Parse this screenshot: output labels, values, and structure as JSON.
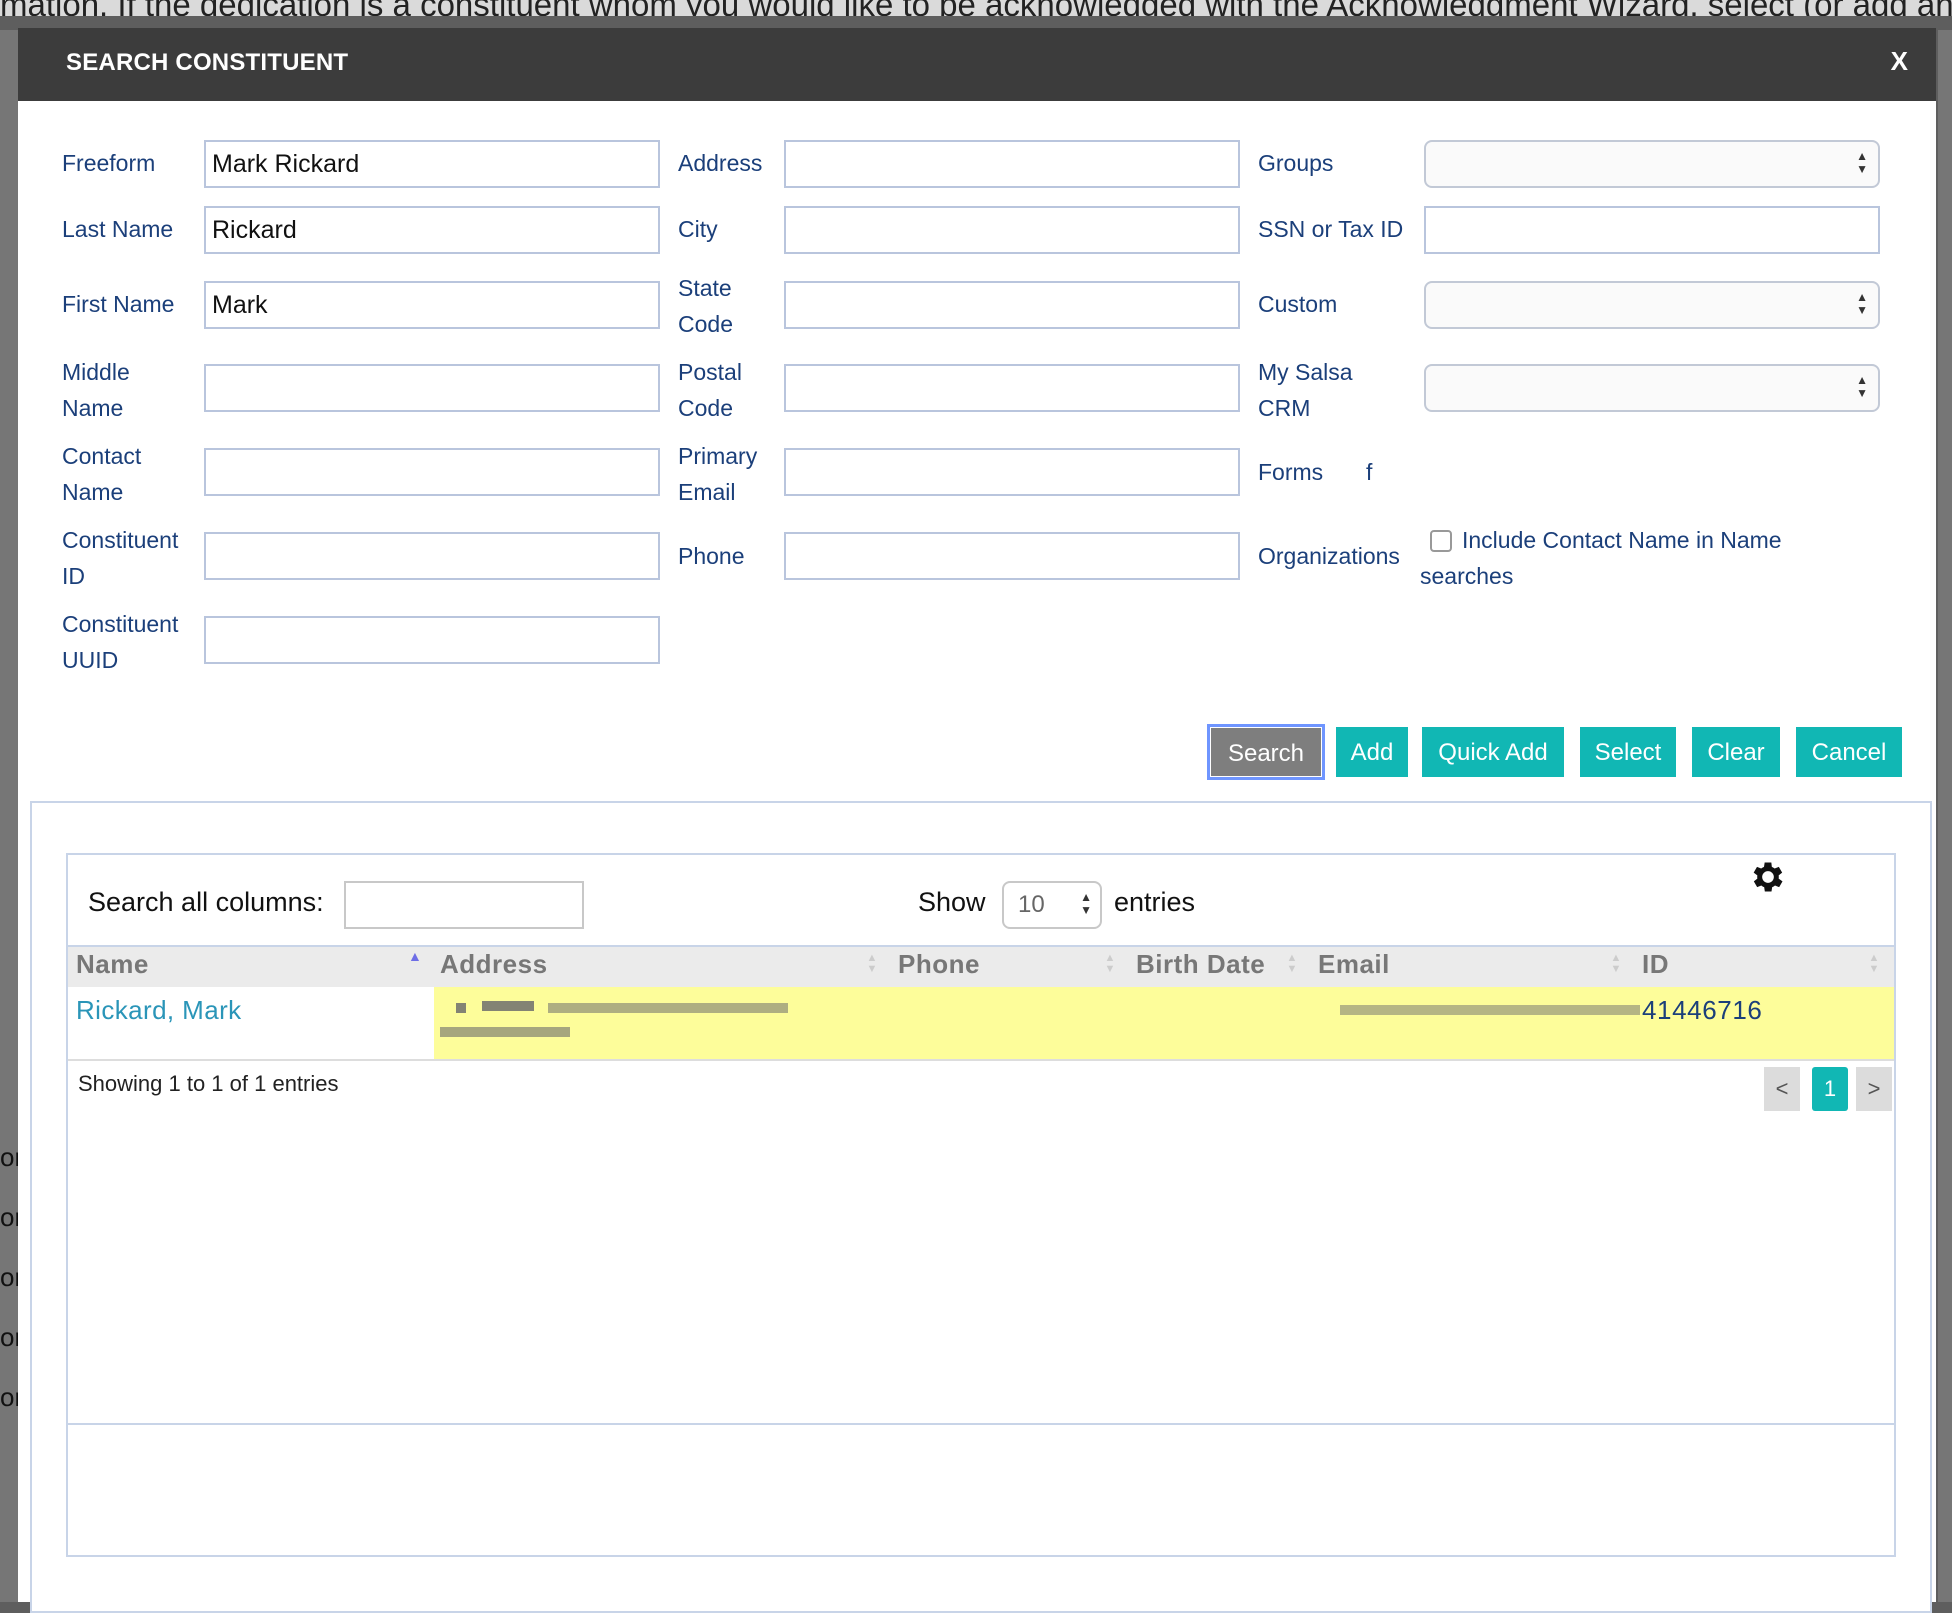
{
  "background": {
    "page_text": "mation. If the dedication is a constituent whom you would like to be acknowledged with the Acknowledgment Wizard, select (or add and select",
    "left_stubs": [
      "on",
      "on",
      "on",
      "on",
      "on"
    ]
  },
  "modal": {
    "title": "SEARCH CONSTITUENT",
    "close_label": "X"
  },
  "form": {
    "col1": {
      "freeform": {
        "label": "Freeform",
        "value": "Mark Rickard"
      },
      "last_name": {
        "label": "Last Name",
        "value": "Rickard"
      },
      "first_name": {
        "label": "First Name",
        "value": "Mark"
      },
      "middle_name": {
        "label_line1": "Middle",
        "label_line2": "Name",
        "value": ""
      },
      "contact_name": {
        "label_line1": "Contact",
        "label_line2": "Name",
        "value": ""
      },
      "constituent_id": {
        "label_line1": "Constituent",
        "label_line2": "ID",
        "value": ""
      },
      "constituent_uuid": {
        "label_line1": "Constituent",
        "label_line2": "UUID",
        "value": ""
      }
    },
    "col2": {
      "address": {
        "label": "Address",
        "value": ""
      },
      "city": {
        "label": "City",
        "value": ""
      },
      "state_code": {
        "label_line1": "State",
        "label_line2": "Code",
        "value": ""
      },
      "postal_code": {
        "label_line1": "Postal",
        "label_line2": "Code",
        "value": ""
      },
      "primary_email": {
        "label_line1": "Primary",
        "label_line2": "Email",
        "value": ""
      },
      "phone": {
        "label": "Phone",
        "value": ""
      }
    },
    "col3": {
      "groups": {
        "label": "Groups",
        "value": ""
      },
      "ssn": {
        "label": "SSN or Tax ID",
        "value": ""
      },
      "custom": {
        "label": "Custom",
        "value": ""
      },
      "my_salsa_crm": {
        "label_line1": "My Salsa",
        "label_line2": "CRM",
        "value": ""
      },
      "forms": {
        "label": "Forms",
        "value": "f"
      },
      "organizations": {
        "label": "Organizations",
        "checkbox_label_line1": "Include Contact Name in Name",
        "checkbox_label_line2": "searches",
        "checked": false
      }
    }
  },
  "buttons": {
    "search": "Search",
    "add": "Add",
    "quick_add": "Quick Add",
    "select": "Select",
    "clear": "Clear",
    "cancel": "Cancel"
  },
  "results": {
    "search_all_label": "Search all columns:",
    "search_all_value": "",
    "show_label": "Show",
    "show_value": "10",
    "entries_label": "entries",
    "columns": [
      "Name",
      "Address",
      "Phone",
      "Birth Date",
      "Email",
      "ID"
    ],
    "sort_column": "Name",
    "rows": [
      {
        "name": "Rickard, Mark",
        "address": "",
        "phone": "",
        "birth_date": "",
        "email": "",
        "id": "41446716"
      }
    ],
    "info": "Showing 1 to 1 of 1 entries",
    "pager": {
      "prev": "<",
      "current": "1",
      "next": ">"
    }
  },
  "colors": {
    "accent": "#11b7b4",
    "title_bar": "#3c3c3c",
    "label_text": "#1b3f7a",
    "link_text": "#2a95b8",
    "row_highlight": "#fdfd9a"
  }
}
